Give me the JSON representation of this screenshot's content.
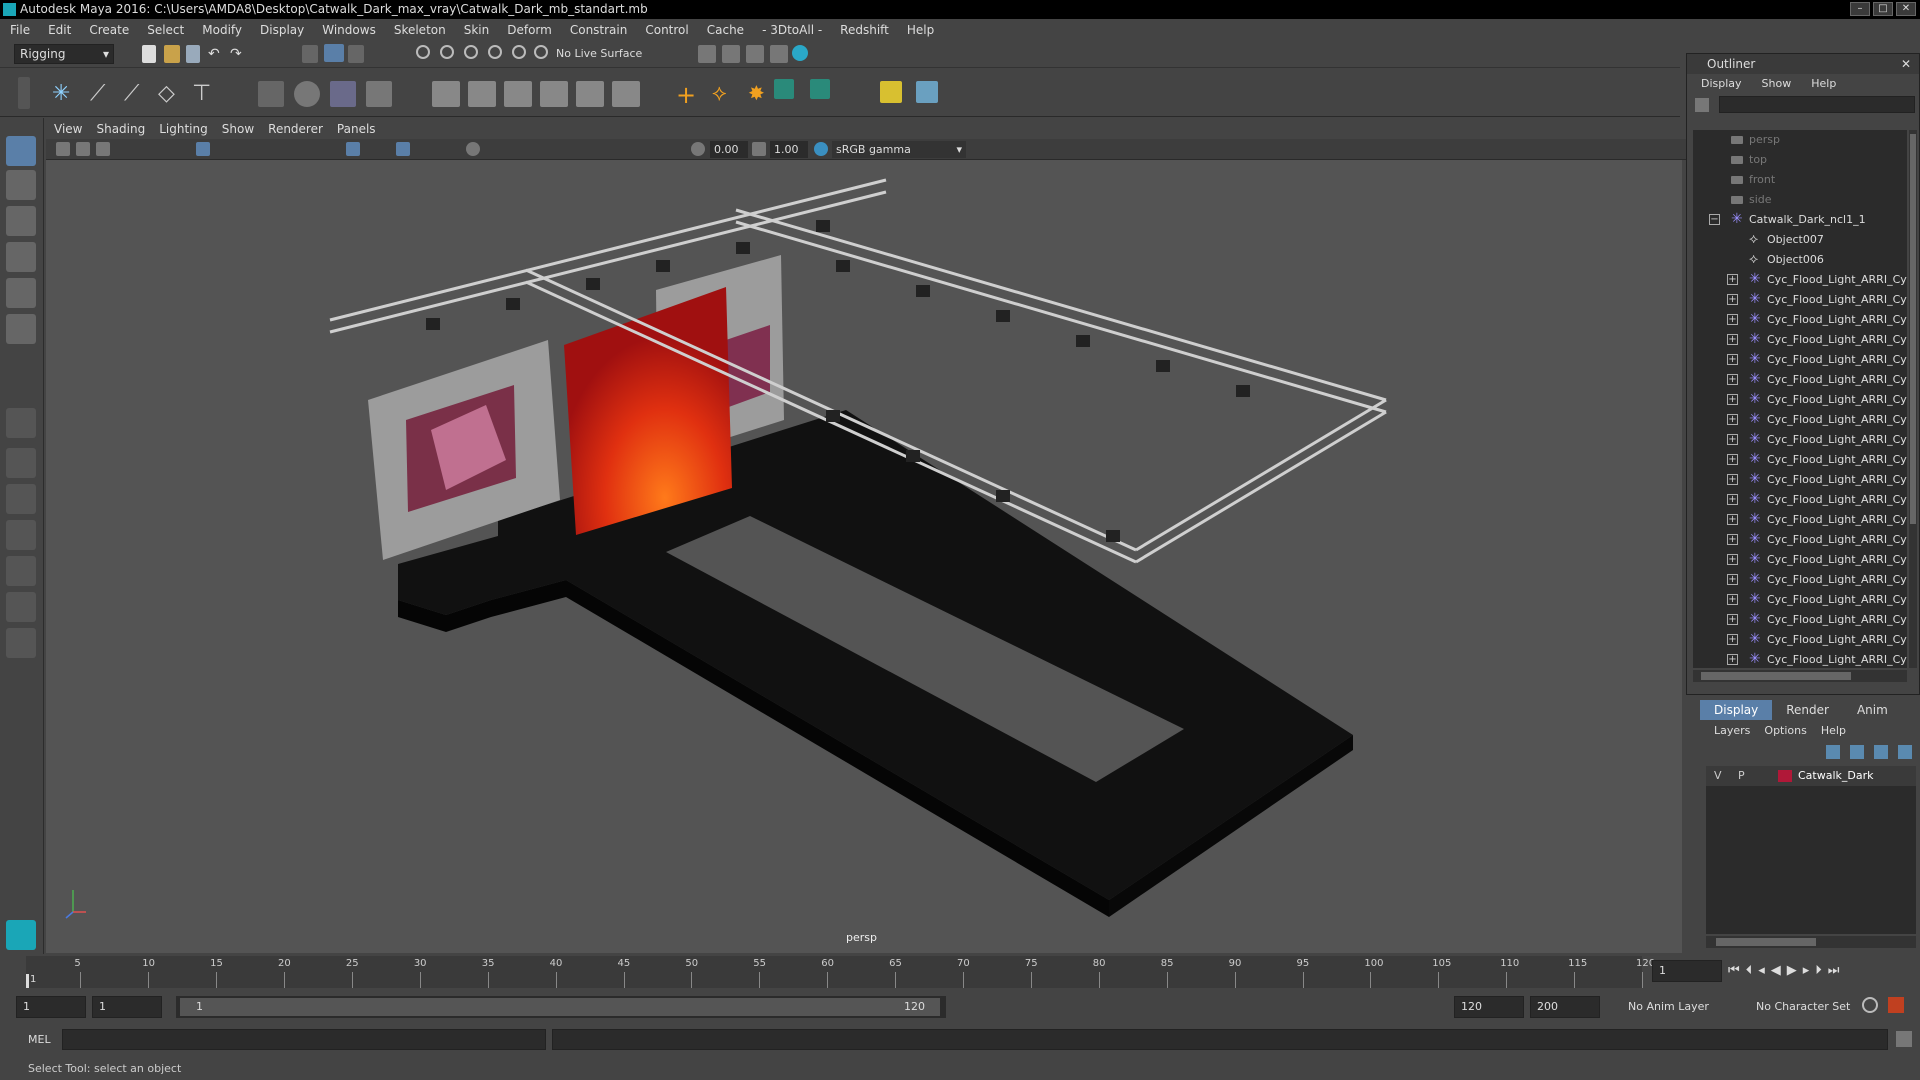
{
  "window": {
    "title": "Autodesk Maya 2016: C:\\Users\\AMDA8\\Desktop\\Catwalk_Dark_max_vray\\Catwalk_Dark_mb_standart.mb"
  },
  "menubar": [
    "File",
    "Edit",
    "Create",
    "Select",
    "Modify",
    "Display",
    "Windows",
    "Skeleton",
    "Skin",
    "Deform",
    "Constrain",
    "Control",
    "Cache",
    "- 3DtoAll -",
    "Redshift",
    "Help"
  ],
  "statusline": {
    "mode": "Rigging",
    "live_surface": "No Live Surface"
  },
  "panel": {
    "menus": [
      "View",
      "Shading",
      "Lighting",
      "Show",
      "Renderer",
      "Panels"
    ],
    "gamma_value1": "0.00",
    "gamma_value2": "1.00",
    "colorspace": "sRGB gamma",
    "camera_label": "persp"
  },
  "outliner": {
    "title": "Outliner",
    "menus": [
      "Display",
      "Show",
      "Help"
    ],
    "cameras": [
      "persp",
      "top",
      "front",
      "side"
    ],
    "group": "Catwalk_Dark_ncl1_1",
    "objects": [
      "Object007",
      "Object006"
    ],
    "lights": [
      "Cyc_Flood_Light_ARRI_Cy",
      "Cyc_Flood_Light_ARRI_Cy",
      "Cyc_Flood_Light_ARRI_Cy",
      "Cyc_Flood_Light_ARRI_Cy",
      "Cyc_Flood_Light_ARRI_Cy",
      "Cyc_Flood_Light_ARRI_Cy",
      "Cyc_Flood_Light_ARRI_Cy",
      "Cyc_Flood_Light_ARRI_Cy",
      "Cyc_Flood_Light_ARRI_Cy",
      "Cyc_Flood_Light_ARRI_Cy",
      "Cyc_Flood_Light_ARRI_Cy",
      "Cyc_Flood_Light_ARRI_Cy",
      "Cyc_Flood_Light_ARRI_Cy",
      "Cyc_Flood_Light_ARRI_Cy",
      "Cyc_Flood_Light_ARRI_Cy",
      "Cyc_Flood_Light_ARRI_Cy",
      "Cyc_Flood_Light_ARRI_Cy",
      "Cyc_Flood_Light_ARRI_Cy",
      "Cyc_Flood_Light_ARRI_Cy",
      "Cyc_Flood_Light_ARRI_Cy"
    ]
  },
  "layers": {
    "tabs": [
      "Display",
      "Render",
      "Anim"
    ],
    "menus": [
      "Layers",
      "Options",
      "Help"
    ],
    "v": "V",
    "p": "P",
    "layer_name": "Catwalk_Dark",
    "layer_color": "#b01838"
  },
  "timeline": {
    "ticks": [
      "5",
      "10",
      "15",
      "20",
      "25",
      "30",
      "35",
      "40",
      "45",
      "50",
      "55",
      "60",
      "65",
      "70",
      "75",
      "80",
      "85",
      "90",
      "95",
      "100",
      "105",
      "110",
      "115",
      "120"
    ],
    "start_tick": "1",
    "current_frame": "1"
  },
  "range": {
    "start": "1",
    "playback_start": "1",
    "slider_start": "1",
    "slider_end": "120",
    "playback_end": "120",
    "end": "200",
    "anim_layer": "No Anim Layer",
    "char_set": "No Character Set"
  },
  "cmd": {
    "label": "MEL"
  },
  "help": {
    "text": "Select Tool: select an object"
  },
  "colors": {
    "accent": "#5a7fa8",
    "viewport_bg": "#545454"
  }
}
